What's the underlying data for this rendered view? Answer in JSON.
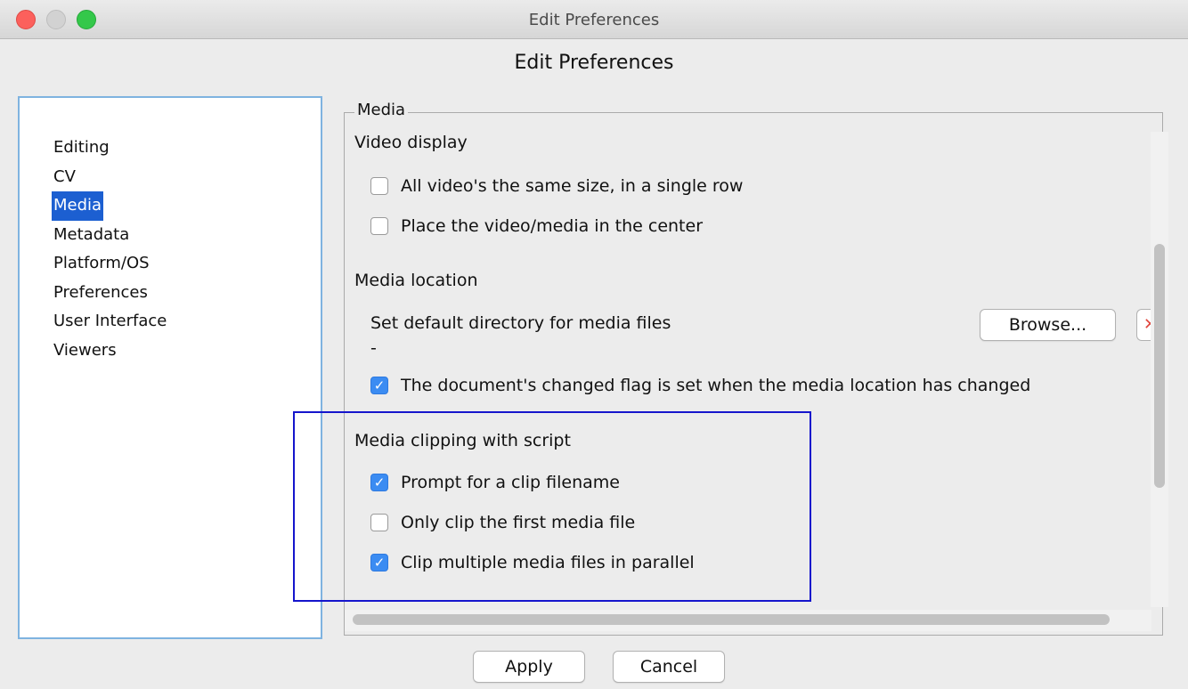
{
  "window": {
    "title": "Edit Preferences"
  },
  "dialog": {
    "heading": "Edit Preferences"
  },
  "sidebar": {
    "items": [
      {
        "label": "Editing",
        "selected": false
      },
      {
        "label": "CV",
        "selected": false
      },
      {
        "label": "Media",
        "selected": true
      },
      {
        "label": "Metadata",
        "selected": false
      },
      {
        "label": "Platform/OS",
        "selected": false
      },
      {
        "label": "Preferences",
        "selected": false
      },
      {
        "label": "User Interface",
        "selected": false
      },
      {
        "label": "Viewers",
        "selected": false
      }
    ]
  },
  "panel": {
    "legend": "Media",
    "video_display": {
      "title": "Video display",
      "options": [
        {
          "label": "All video's the same size, in a single row",
          "checked": false
        },
        {
          "label": "Place the video/media in the center",
          "checked": false
        }
      ]
    },
    "media_location": {
      "title": "Media location",
      "default_dir_label": "Set default directory for media files",
      "default_dir_value": "-",
      "browse_label": "Browse...",
      "changed_flag": {
        "label": "The document's changed flag is set when the media location has changed",
        "checked": true
      }
    },
    "media_clipping": {
      "title": "Media clipping with script",
      "options": [
        {
          "label": "Prompt for a clip filename",
          "checked": true
        },
        {
          "label": "Only clip the first media file",
          "checked": false
        },
        {
          "label": "Clip multiple media files in parallel",
          "checked": true
        }
      ]
    }
  },
  "footer": {
    "apply_label": "Apply",
    "cancel_label": "Cancel"
  },
  "colors": {
    "selection": "#1c5fd1",
    "checkbox_checked": "#3b8cf2",
    "highlight_box": "#1515cc"
  },
  "icons": {
    "checkmark": "checkmark-icon",
    "close": "close-window-icon",
    "minimize": "minimize-window-icon",
    "maximize": "maximize-window-icon"
  }
}
